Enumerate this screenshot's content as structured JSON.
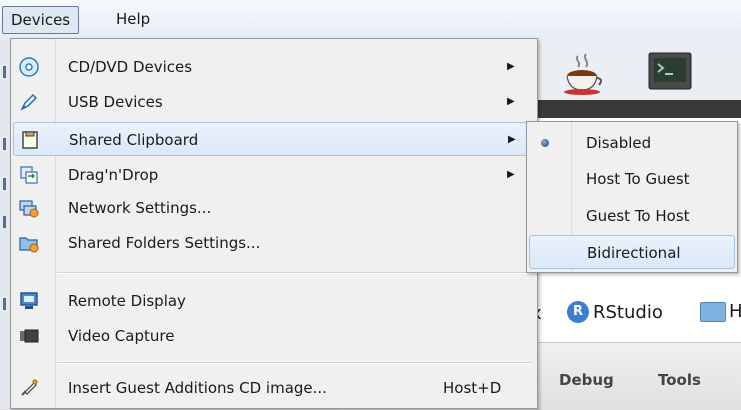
{
  "menubar": {
    "items": [
      {
        "label": "Devices"
      },
      {
        "label": "Help"
      }
    ]
  },
  "devices_menu": {
    "items": [
      {
        "label": "CD/DVD Devices",
        "icon": "cd-dvd-icon",
        "submenu": true
      },
      {
        "label": "USB Devices",
        "icon": "usb-icon",
        "submenu": true
      },
      {
        "label": "Shared Clipboard",
        "icon": "clipboard-icon",
        "submenu": true,
        "highlighted": true
      },
      {
        "label": "Drag'n'Drop",
        "icon": "drag-drop-icon",
        "submenu": true
      },
      {
        "label": "Network Settings...",
        "icon": "network-settings-icon"
      },
      {
        "label": "Shared Folders Settings...",
        "icon": "shared-folders-icon"
      },
      {
        "label": "Remote Display",
        "icon": "remote-display-icon"
      },
      {
        "label": "Video Capture",
        "icon": "video-capture-icon"
      },
      {
        "label": "Insert Guest Additions CD image...",
        "icon": "guest-additions-icon",
        "shortcut": "Host+D"
      }
    ]
  },
  "clipboard_submenu": {
    "items": [
      {
        "label": "Disabled",
        "selected": true
      },
      {
        "label": "Host To Guest"
      },
      {
        "label": "Guest To Host"
      },
      {
        "label": "Bidirectional",
        "highlighted": true
      }
    ]
  },
  "background": {
    "bookmark_close": "x",
    "bookmark_rstudio": "RStudio",
    "bookmark_rstudio_badge": "R",
    "bookmark_h": "H",
    "tab_debug": "Debug",
    "tab_tools": "Tools"
  },
  "colors": {
    "highlight_bg": "#dbe8f7",
    "highlight_border": "#a9c4e3",
    "menu_bg": "#f0f0f0"
  }
}
